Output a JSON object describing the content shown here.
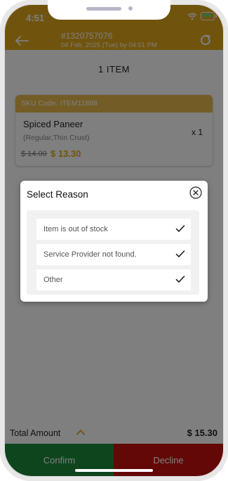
{
  "status_bar": {
    "time": "4:51"
  },
  "header": {
    "order_number": "#1320757076",
    "order_datetime": "04 Feb, 2025 (Tue) by 04:51 PM"
  },
  "items_title": "1 ITEM",
  "item_card": {
    "sku": "SKU Code: ITEM11888",
    "name": "Spiced Paneer",
    "variant": "(Regular,Thin Crust)",
    "old_price": "$ 14.00",
    "price": "$ 13.30",
    "quantity": "x 1"
  },
  "modal": {
    "title": "Select Reason",
    "reasons": [
      {
        "label": "Item is out of stock"
      },
      {
        "label": "Service Provider not found."
      },
      {
        "label": "Other"
      }
    ]
  },
  "footer": {
    "total_label": "Total Amount",
    "total_value": "$ 15.30",
    "confirm_label": "Confirm",
    "decline_label": "Decline"
  },
  "colors": {
    "brand": "#e0a81c",
    "confirm": "#1e8a3a",
    "decline": "#c7110e"
  }
}
